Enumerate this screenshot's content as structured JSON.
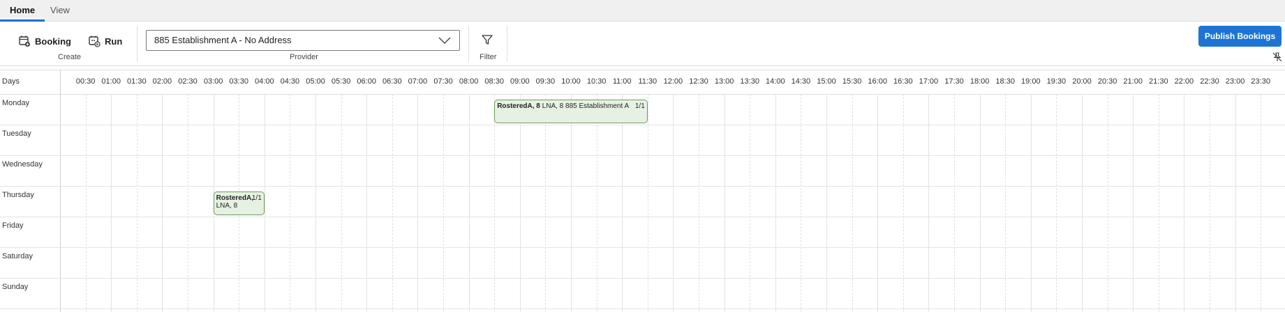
{
  "tabs": [
    {
      "label": "Home"
    },
    {
      "label": "View"
    }
  ],
  "ribbon": {
    "booking_label": "Booking",
    "run_label": "Run",
    "create_group": "Create",
    "provider_value": "885 Establishment A - No Address",
    "provider_group": "Provider",
    "filter_group": "Filter",
    "publish_label": "Publish Bookings"
  },
  "grid": {
    "days_title": "Days",
    "times": [
      "00:30",
      "01:00",
      "01:30",
      "02:00",
      "02:30",
      "03:00",
      "03:30",
      "04:00",
      "04:30",
      "05:00",
      "05:30",
      "06:00",
      "06:30",
      "07:00",
      "07:30",
      "08:00",
      "08:30",
      "09:00",
      "09:30",
      "10:00",
      "10:30",
      "11:00",
      "11:30",
      "12:00",
      "12:30",
      "13:00",
      "13:30",
      "14:00",
      "14:30",
      "15:00",
      "15:30",
      "16:00",
      "16:30",
      "17:00",
      "17:30",
      "18:00",
      "18:30",
      "19:00",
      "19:30",
      "20:00",
      "20:30",
      "21:00",
      "21:30",
      "22:00",
      "22:30",
      "23:00",
      "23:30"
    ],
    "days": [
      "Monday",
      "Tuesday",
      "Wednesday",
      "Thursday",
      "Friday",
      "Saturday",
      "Sunday"
    ]
  },
  "bookings": [
    {
      "name": "RosteredA, 8",
      "detail": "LNA, 8 885 Establishment A",
      "ratio": "1/1",
      "day": "Monday",
      "start": "08:30",
      "end": "11:30"
    },
    {
      "name": "RosteredA,",
      "detail": "LNA, 8",
      "ratio": "1/1",
      "day": "Thursday",
      "start": "03:00",
      "end": "04:00"
    }
  ]
}
